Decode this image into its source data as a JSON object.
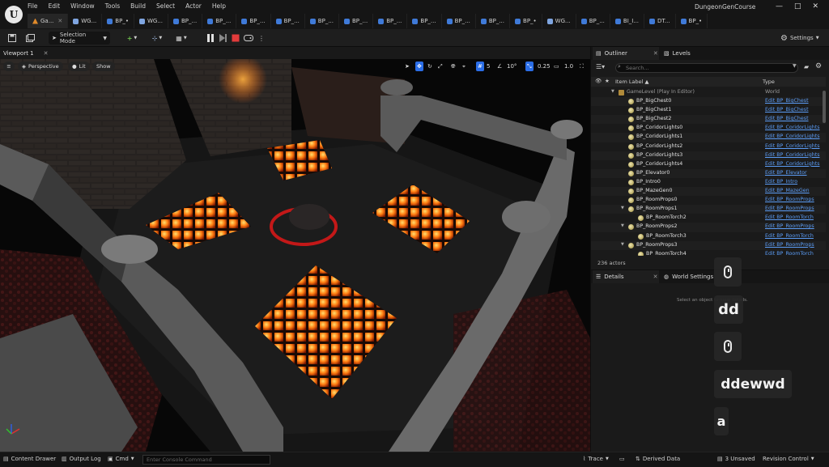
{
  "window": {
    "project_name": "DungeonGenCourse",
    "controls": {
      "minimize": "—",
      "maximize": "□",
      "close": "✕"
    }
  },
  "menu": [
    "File",
    "Edit",
    "Window",
    "Tools",
    "Build",
    "Select",
    "Actor",
    "Help"
  ],
  "tabs": [
    {
      "label": "Ga...",
      "icon": "level-icon",
      "active": true
    },
    {
      "label": "WG...",
      "icon": "widget-icon"
    },
    {
      "label": "BP_•",
      "icon": "blueprint-icon"
    },
    {
      "label": "WG...",
      "icon": "widget-icon"
    },
    {
      "label": "BP_...",
      "icon": "blueprint-icon"
    },
    {
      "label": "BP_...",
      "icon": "blueprint-icon"
    },
    {
      "label": "BP_...",
      "icon": "blueprint-icon"
    },
    {
      "label": "BP_...",
      "icon": "blueprint-icon"
    },
    {
      "label": "BP_...",
      "icon": "blueprint-icon"
    },
    {
      "label": "BP_...",
      "icon": "blueprint-icon"
    },
    {
      "label": "BP_...",
      "icon": "blueprint-icon"
    },
    {
      "label": "BP_...",
      "icon": "blueprint-icon"
    },
    {
      "label": "BP_...",
      "icon": "blueprint-icon"
    },
    {
      "label": "BP_...",
      "icon": "blueprint-icon"
    },
    {
      "label": "BP_•",
      "icon": "blueprint-icon"
    },
    {
      "label": "WG...",
      "icon": "widget-icon"
    },
    {
      "label": "BP_...",
      "icon": "blueprint-icon"
    },
    {
      "label": "BI_I...",
      "icon": "blueprint-icon"
    },
    {
      "label": "DT...",
      "icon": "datatable-icon"
    },
    {
      "label": "BP_•",
      "icon": "blueprint-icon"
    }
  ],
  "toolbar": {
    "mode_label": "Selection Mode",
    "settings_label": "Settings"
  },
  "viewport": {
    "tab_label": "Viewport 1",
    "tab_close": "✕",
    "perspective_label": "Perspective",
    "lit_label": "Lit",
    "show_label": "Show",
    "grid_snap": "5",
    "rotation_snap": "10°",
    "scale_snap": "0.25",
    "camera_speed": "1.0"
  },
  "outliner": {
    "tab_label": "Outliner",
    "tab_close": "✕",
    "levels_tab_label": "Levels",
    "search_placeholder": "Search...",
    "col_label": "Item Label ▲",
    "col_type": "Type",
    "actor_count": "236 actors",
    "rows": [
      {
        "label": "GameLevel (Play In Editor)",
        "type": "World",
        "depth": 0,
        "arrow": true,
        "plain": true
      },
      {
        "label": "BP_BigChest0",
        "type": "Edit BP_BigChest",
        "depth": 1
      },
      {
        "label": "BP_BigChest1",
        "type": "Edit BP_BigChest",
        "depth": 1
      },
      {
        "label": "BP_BigChest2",
        "type": "Edit BP_BigChest",
        "depth": 1
      },
      {
        "label": "BP_CoridorLights0",
        "type": "Edit BP_CoridorLights",
        "depth": 1
      },
      {
        "label": "BP_CoridorLights1",
        "type": "Edit BP_CoridorLights",
        "depth": 1
      },
      {
        "label": "BP_CoridorLights2",
        "type": "Edit BP_CoridorLights",
        "depth": 1
      },
      {
        "label": "BP_CoridorLights3",
        "type": "Edit BP_CoridorLights",
        "depth": 1
      },
      {
        "label": "BP_CoridorLights4",
        "type": "Edit BP_CoridorLights",
        "depth": 1
      },
      {
        "label": "BP_Elevator0",
        "type": "Edit BP_Elevator",
        "depth": 1
      },
      {
        "label": "BP_Intro0",
        "type": "Edit BP_Intro",
        "depth": 1
      },
      {
        "label": "BP_MazeGen0",
        "type": "Edit BP_MazeGen",
        "depth": 1
      },
      {
        "label": "BP_RoomProps0",
        "type": "Edit BP_RoomProps",
        "depth": 1
      },
      {
        "label": "BP_RoomProps1",
        "type": "Edit BP_RoomProps",
        "depth": 1,
        "arrow": true
      },
      {
        "label": "BP_RoomTorch2",
        "type": "Edit BP_RoomTorch",
        "depth": 2
      },
      {
        "label": "BP_RoomProps2",
        "type": "Edit BP_RoomProps",
        "depth": 1,
        "arrow": true
      },
      {
        "label": "BP_RoomTorch3",
        "type": "Edit BP_RoomTorch",
        "depth": 2
      },
      {
        "label": "BP_RoomProps3",
        "type": "Edit BP_RoomProps",
        "depth": 1,
        "arrow": true
      },
      {
        "label": "BP_RoomTorch4",
        "type": "Edit BP_RoomTorch",
        "depth": 2
      }
    ]
  },
  "details": {
    "tab_label": "Details",
    "tab_close": "✕",
    "world_settings_label": "World Settings",
    "hint": "Select an object to view details."
  },
  "key_overlay": [
    "dd",
    "ddewwd",
    "a"
  ],
  "statusbar": {
    "content_drawer": "Content Drawer",
    "output_log": "Output Log",
    "cmd": "Cmd",
    "console_placeholder": "Enter Console Command",
    "trace": "Trace",
    "derived_data": "Derived Data",
    "unsaved": "3 Unsaved",
    "revision_control": "Revision Control"
  }
}
